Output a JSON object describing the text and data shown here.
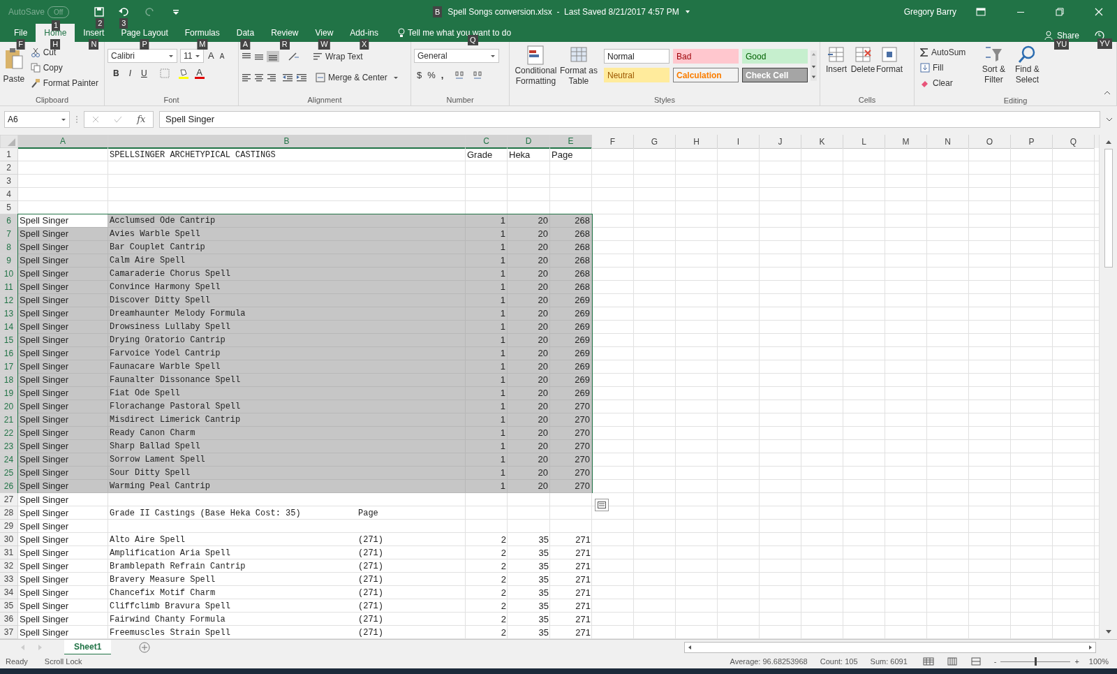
{
  "title_bar": {
    "autosave_label": "AutoSave",
    "autosave_state": "Off",
    "autosave_keytip": "1",
    "save_keytip": "2",
    "undo_keytip": "3",
    "file_keytip": "B",
    "title": "Spell Songs conversion.xlsx  -  Last Saved 8/21/2017 4:57 PM",
    "user": "Gregory Barry"
  },
  "tabs": [
    {
      "label": "File",
      "keytip": "F",
      "selected": false
    },
    {
      "label": "Home",
      "keytip": "H",
      "selected": true
    },
    {
      "label": "Insert",
      "keytip": "N",
      "selected": false
    },
    {
      "label": "Page Layout",
      "keytip": "P",
      "selected": false
    },
    {
      "label": "Formulas",
      "keytip": "M",
      "selected": false
    },
    {
      "label": "Data",
      "keytip": "A",
      "selected": false
    },
    {
      "label": "Review",
      "keytip": "R",
      "selected": false
    },
    {
      "label": "View",
      "keytip": "W",
      "selected": false
    },
    {
      "label": "Add-ins",
      "keytip": "X",
      "selected": false
    }
  ],
  "tell_me": {
    "text": "Tell me what you want to do",
    "keytip": "Q"
  },
  "share": {
    "label": "Share",
    "keytip": "YU",
    "history_keytip": "YV"
  },
  "ribbon": {
    "clipboard": {
      "label": "Clipboard",
      "paste": "Paste",
      "cut": "Cut",
      "copy": "Copy",
      "format_painter": "Format Painter"
    },
    "font": {
      "label": "Font",
      "name": "Calibri",
      "size": "11",
      "grow": "A",
      "shrink": "A",
      "bold": "B",
      "italic": "I",
      "underline": "U",
      "font_color_letter": "A"
    },
    "alignment": {
      "label": "Alignment",
      "wrap": "Wrap Text",
      "merge": "Merge & Center"
    },
    "number": {
      "label": "Number",
      "format": "General",
      "currency": "$",
      "percent": "%",
      "comma": ","
    },
    "styles": {
      "label": "Styles",
      "conditional": [
        "Conditional",
        "Formatting"
      ],
      "table": [
        "Format as",
        "Table"
      ],
      "cells": [
        {
          "label": "Normal",
          "kind": "normal"
        },
        {
          "label": "Bad",
          "kind": "bad"
        },
        {
          "label": "Good",
          "kind": "good"
        },
        {
          "label": "Neutral",
          "kind": "neutral"
        },
        {
          "label": "Calculation",
          "kind": "calculation"
        },
        {
          "label": "Check Cell",
          "kind": "check"
        }
      ]
    },
    "cells": {
      "label": "Cells",
      "buttons": [
        "Insert",
        "Delete",
        "Format"
      ]
    },
    "editing": {
      "label": "Editing",
      "autosum": "AutoSum",
      "fill": "Fill",
      "clear": "Clear",
      "sort": [
        "Sort &",
        "Filter"
      ],
      "find": [
        "Find &",
        "Select"
      ]
    }
  },
  "formula_bar": {
    "name_box": "A6",
    "fx": "fx",
    "value": "Spell Singer"
  },
  "columns": [
    {
      "label": "A",
      "selected": true
    },
    {
      "label": "B",
      "selected": true
    },
    {
      "label": "C",
      "selected": true
    },
    {
      "label": "D",
      "selected": true
    },
    {
      "label": "E",
      "selected": true
    },
    {
      "label": "F",
      "selected": false
    },
    {
      "label": "G",
      "selected": false
    },
    {
      "label": "H",
      "selected": false
    },
    {
      "label": "I",
      "selected": false
    },
    {
      "label": "J",
      "selected": false
    },
    {
      "label": "K",
      "selected": false
    },
    {
      "label": "L",
      "selected": false
    },
    {
      "label": "M",
      "selected": false
    },
    {
      "label": "N",
      "selected": false
    },
    {
      "label": "O",
      "selected": false
    },
    {
      "label": "P",
      "selected": false
    },
    {
      "label": "Q",
      "selected": false
    }
  ],
  "rows": [
    {
      "number": "1",
      "b": "SPELLSINGER ARCHETYPICAL CASTINGS",
      "c": "Grade",
      "d": "Heka",
      "e": "Page",
      "selected": false
    },
    {
      "number": "2",
      "selected": false
    },
    {
      "number": "3",
      "selected": false
    },
    {
      "number": "4",
      "selected": false
    },
    {
      "number": "5",
      "selected": false
    },
    {
      "number": "6",
      "a": "Spell Singer",
      "b": "Acclumsed Ode Cantrip",
      "c": "1",
      "d": "20",
      "e": "268",
      "selected": true,
      "active": true
    },
    {
      "number": "7",
      "a": "Spell Singer",
      "b": "Avies Warble Spell",
      "c": "1",
      "d": "20",
      "e": "268",
      "selected": true
    },
    {
      "number": "8",
      "a": "Spell Singer",
      "b": "Bar Couplet Cantrip",
      "c": "1",
      "d": "20",
      "e": "268",
      "selected": true
    },
    {
      "number": "9",
      "a": "Spell Singer",
      "b": "Calm Aire Spell",
      "c": "1",
      "d": "20",
      "e": "268",
      "selected": true
    },
    {
      "number": "10",
      "a": "Spell Singer",
      "b": "Camaraderie Chorus Spell",
      "c": "1",
      "d": "20",
      "e": "268",
      "selected": true
    },
    {
      "number": "11",
      "a": "Spell Singer",
      "b": "Convince Harmony Spell",
      "c": "1",
      "d": "20",
      "e": "268",
      "selected": true
    },
    {
      "number": "12",
      "a": "Spell Singer",
      "b": "Discover Ditty Spell",
      "c": "1",
      "d": "20",
      "e": "269",
      "selected": true
    },
    {
      "number": "13",
      "a": "Spell Singer",
      "b": "Dreamhaunter Melody Formula",
      "c": "1",
      "d": "20",
      "e": "269",
      "selected": true
    },
    {
      "number": "14",
      "a": "Spell Singer",
      "b": "Drowsiness Lullaby Spell",
      "c": "1",
      "d": "20",
      "e": "269",
      "selected": true
    },
    {
      "number": "15",
      "a": "Spell Singer",
      "b": "Drying Oratorio Cantrip",
      "c": "1",
      "d": "20",
      "e": "269",
      "selected": true
    },
    {
      "number": "16",
      "a": "Spell Singer",
      "b": "Farvoice Yodel Cantrip",
      "c": "1",
      "d": "20",
      "e": "269",
      "selected": true
    },
    {
      "number": "17",
      "a": "Spell Singer",
      "b": "Faunacare Warble Spell",
      "c": "1",
      "d": "20",
      "e": "269",
      "selected": true
    },
    {
      "number": "18",
      "a": "Spell Singer",
      "b": "Faunalter Dissonance Spell",
      "c": "1",
      "d": "20",
      "e": "269",
      "selected": true
    },
    {
      "number": "19",
      "a": "Spell Singer",
      "b": "Fiat Ode Spell",
      "c": "1",
      "d": "20",
      "e": "269",
      "selected": true
    },
    {
      "number": "20",
      "a": "Spell Singer",
      "b": "Florachange Pastoral Spell",
      "c": "1",
      "d": "20",
      "e": "270",
      "selected": true
    },
    {
      "number": "21",
      "a": "Spell Singer",
      "b": "Misdirect Limerick Cantrip",
      "c": "1",
      "d": "20",
      "e": "270",
      "selected": true
    },
    {
      "number": "22",
      "a": "Spell Singer",
      "b": "Ready Canon Charm",
      "c": "1",
      "d": "20",
      "e": "270",
      "selected": true
    },
    {
      "number": "23",
      "a": "Spell Singer",
      "b": "Sharp Ballad Spell",
      "c": "1",
      "d": "20",
      "e": "270",
      "selected": true
    },
    {
      "number": "24",
      "a": "Spell Singer",
      "b": "Sorrow Lament Spell",
      "c": "1",
      "d": "20",
      "e": "270",
      "selected": true
    },
    {
      "number": "25",
      "a": "Spell Singer",
      "b": "Sour Ditty Spell",
      "c": "1",
      "d": "20",
      "e": "270",
      "selected": true
    },
    {
      "number": "26",
      "a": "Spell Singer",
      "b": "Warming Peal Cantrip",
      "c": "1",
      "d": "20",
      "e": "270",
      "selected": true
    },
    {
      "number": "27",
      "a": "Spell Singer",
      "selected": false
    },
    {
      "number": "28",
      "a": "Spell Singer",
      "b": "Grade II Castings (Base Heka Cost: 35)",
      "b_page": "Page",
      "selected": false
    },
    {
      "number": "29",
      "a": "Spell Singer",
      "selected": false
    },
    {
      "number": "30",
      "a": "Spell Singer",
      "b": "Alto Aire Spell",
      "b_page": "(271)",
      "c": "2",
      "d": "35",
      "e": "271",
      "selected": false
    },
    {
      "number": "31",
      "a": "Spell Singer",
      "b": "Amplification Aria Spell",
      "b_page": "(271)",
      "c": "2",
      "d": "35",
      "e": "271",
      "selected": false
    },
    {
      "number": "32",
      "a": "Spell Singer",
      "b": "Bramblepath Refrain Cantrip",
      "b_page": "(271)",
      "c": "2",
      "d": "35",
      "e": "271",
      "selected": false
    },
    {
      "number": "33",
      "a": "Spell Singer",
      "b": "Bravery Measure Spell",
      "b_page": "(271)",
      "c": "2",
      "d": "35",
      "e": "271",
      "selected": false
    },
    {
      "number": "34",
      "a": "Spell Singer",
      "b": "Chancefix Motif Charm",
      "b_page": "(271)",
      "c": "2",
      "d": "35",
      "e": "271",
      "selected": false
    },
    {
      "number": "35",
      "a": "Spell Singer",
      "b": "Cliffclimb Bravura Spell",
      "b_page": "(271)",
      "c": "2",
      "d": "35",
      "e": "271",
      "selected": false
    },
    {
      "number": "36",
      "a": "Spell Singer",
      "b": "Fairwind Chanty Formula",
      "b_page": "(271)",
      "c": "2",
      "d": "35",
      "e": "271",
      "selected": false
    },
    {
      "number": "37",
      "a": "Spell Singer",
      "b": "Freemuscles Strain Spell",
      "b_page": "(271)",
      "c": "2",
      "d": "35",
      "e": "271",
      "selected": false
    }
  ],
  "sheet_tabs": [
    {
      "label": "Sheet1",
      "selected": true
    }
  ],
  "status_bar": {
    "mode": "Ready",
    "scroll_lock": "Scroll Lock",
    "average": "Average: 96.68253968",
    "count": "Count: 105",
    "sum": "Sum: 6091",
    "zoom_out": "-",
    "zoom_in": "+",
    "zoom": "100%",
    "zoom_level": {
      "level": 0.5
    }
  }
}
